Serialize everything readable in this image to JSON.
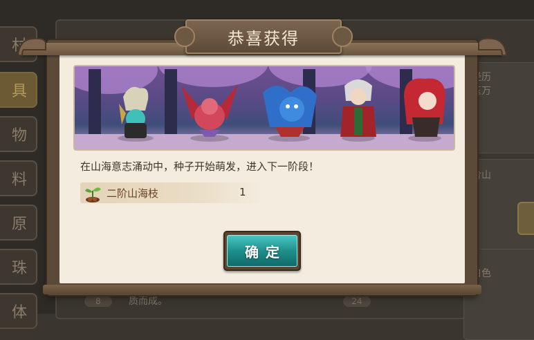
{
  "background": {
    "tabs": [
      "村",
      "具",
      "物",
      "料",
      "原",
      "珠",
      "体"
    ],
    "active_tab_index": 1,
    "side_texts": [
      "经历",
      "玉万",
      "阶山",
      "白色"
    ],
    "bottom_text": "质而成。",
    "pills": [
      "8",
      "24"
    ]
  },
  "dialog": {
    "title": "恭喜获得",
    "message": "在山海意志涌动中，种子开始萌发，进入下一阶段！",
    "reward": {
      "name": "二阶山海枝",
      "count": "1",
      "icon": "sprout-icon"
    },
    "confirm_label": "确定"
  },
  "colors": {
    "paper": "#f4ecdf",
    "frame": "#5b4a38",
    "button": "#1f8f8c",
    "title_text": "#f4e7cf"
  }
}
